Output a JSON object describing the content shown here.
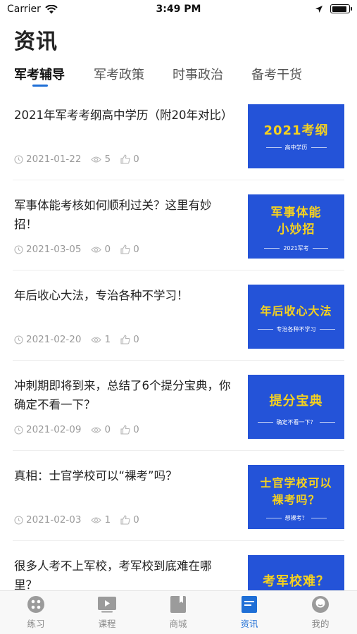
{
  "status": {
    "carrier": "Carrier",
    "time": "3:49 PM",
    "battery_level": 0.9
  },
  "page": {
    "title": "资讯"
  },
  "tabs": [
    {
      "label": "军考辅导",
      "active": true
    },
    {
      "label": "军考政策",
      "active": false
    },
    {
      "label": "时事政治",
      "active": false
    },
    {
      "label": "备考干货",
      "active": false
    }
  ],
  "articles": [
    {
      "title": "2021年军考考纲高中学历（附20年对比）",
      "date": "2021-01-22",
      "views": "5",
      "likes": "0",
      "thumb": {
        "lines": [
          "2021考纲"
        ],
        "sub": "高中学历"
      }
    },
    {
      "title": "军事体能考核如何顺利过关？这里有妙招！",
      "date": "2021-03-05",
      "views": "0",
      "likes": "0",
      "thumb": {
        "lines": [
          "军事体能",
          "小妙招"
        ],
        "sub": "2021军考"
      }
    },
    {
      "title": "年后收心大法，专治各种不学习！",
      "date": "2021-02-20",
      "views": "1",
      "likes": "0",
      "thumb": {
        "lines": [
          "年后收心大法"
        ],
        "sub": "专治各种不学习"
      }
    },
    {
      "title": "冲刺期即将到来，总结了6个提分宝典，你确定不看一下？",
      "date": "2021-02-09",
      "views": "0",
      "likes": "0",
      "thumb": {
        "lines": [
          "提分宝典"
        ],
        "sub": "确定不看一下？"
      }
    },
    {
      "title": "真相：士官学校可以“裸考”吗？",
      "date": "2021-02-03",
      "views": "1",
      "likes": "0",
      "thumb": {
        "lines": [
          "士官学校可以",
          "裸考吗？"
        ],
        "sub": "想裸考？"
      }
    },
    {
      "title": "很多人考不上军校，考军校到底难在哪里？",
      "date": "",
      "views": "",
      "likes": "",
      "thumb": {
        "lines": [
          "考军校难？"
        ],
        "sub": ""
      }
    }
  ],
  "colors": {
    "accent": "#1f6fd6",
    "thumb_bg": "#2453d8",
    "thumb_text": "#f5d11f"
  },
  "tabbar": [
    {
      "label": "练习",
      "icon": "practice-icon",
      "active": false
    },
    {
      "label": "课程",
      "icon": "course-play-icon",
      "active": false
    },
    {
      "label": "商城",
      "icon": "shop-book-icon",
      "active": false
    },
    {
      "label": "资讯",
      "icon": "news-icon",
      "active": true
    },
    {
      "label": "我的",
      "icon": "profile-icon",
      "active": false
    }
  ]
}
